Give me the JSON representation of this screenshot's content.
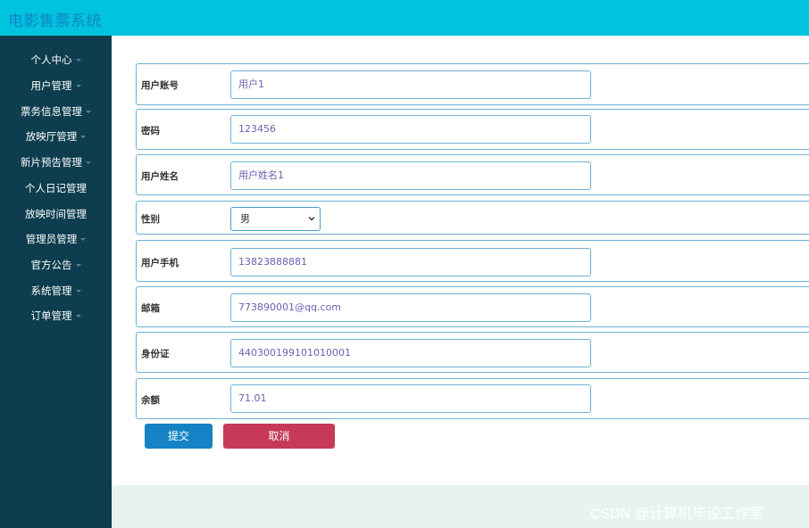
{
  "app": {
    "title": "电影售票系统"
  },
  "sidebar": {
    "items": [
      {
        "label": "个人中心"
      },
      {
        "label": "用户管理"
      },
      {
        "label": "票务信息管理"
      },
      {
        "label": "放映厅管理"
      },
      {
        "label": "新片预告管理"
      },
      {
        "label": "个人日记管理"
      },
      {
        "label": "放映时间管理"
      },
      {
        "label": "管理员管理"
      },
      {
        "label": "官方公告"
      },
      {
        "label": "系统管理"
      },
      {
        "label": "订单管理"
      }
    ]
  },
  "form": {
    "account": {
      "label": "用户账号",
      "value": "用户1"
    },
    "password": {
      "label": "密码",
      "value": "123456"
    },
    "name": {
      "label": "用户姓名",
      "value": "用户姓名1"
    },
    "gender": {
      "label": "性别",
      "value": "男"
    },
    "phone": {
      "label": "用户手机",
      "value": "13823888881"
    },
    "email": {
      "label": "邮箱",
      "value": "773890001@qq.com"
    },
    "idcard": {
      "label": "身份证",
      "value": "440300199101010001"
    },
    "balance": {
      "label": "余额",
      "value": "71.01"
    },
    "submit_label": "提交",
    "cancel_label": "取消"
  },
  "watermark": "CSDN @计算机毕设工作室",
  "colors": {
    "topbar": "#00c3dd",
    "sidebar": "#0d3d4e",
    "submit": "#1582c5",
    "cancel": "#c63a57",
    "border": "#6fb1d3"
  }
}
